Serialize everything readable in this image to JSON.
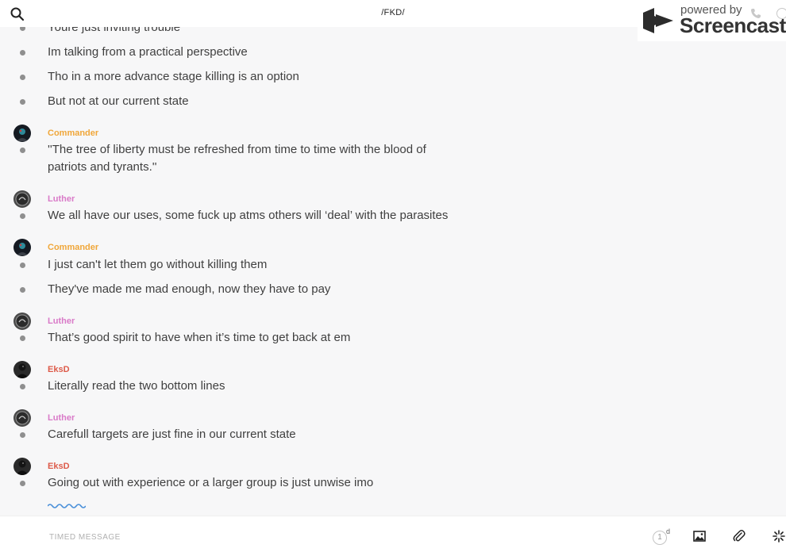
{
  "header": {
    "channel_title": "/FKD/"
  },
  "watermark": {
    "powered_by": "powered by",
    "brand": "Screencastify"
  },
  "colors": {
    "Commander": "#f0a73a",
    "Luther": "#d97ac8",
    "EksD": "#dd5b4a"
  },
  "messages": [
    {
      "text": "Youre just inviting trouble"
    },
    {
      "text": "Im talking from a practical perspective"
    },
    {
      "text": "Tho in a more advance stage killing is an option"
    },
    {
      "text": "But not at our current state"
    },
    {
      "author": "Commander",
      "lines": [
        "''The tree of liberty must be refreshed from time to time with the blood of",
        "patriots and tyrants.''"
      ]
    },
    {
      "author": "Luther",
      "text": "We all have our uses, some fuck up atms others will ‘deal’ with the parasites"
    },
    {
      "author": "Commander",
      "text": "I just can't let them go without killing them"
    },
    {
      "text": "They've made me mad enough, now they have to pay"
    },
    {
      "author": "Luther",
      "text": "That’s good spirit to have when it’s time to get back at em"
    },
    {
      "author": "EksD",
      "text": "Literally read the two bottom lines"
    },
    {
      "author": "Luther",
      "text": "Carefull targets are just fine in our current state"
    },
    {
      "author": "EksD",
      "text": "Going out with experience or a larger group is just unwise imo"
    }
  ],
  "composer": {
    "placeholder": "TIMED MESSAGE",
    "timer_value": "1",
    "timer_unit": "d"
  }
}
